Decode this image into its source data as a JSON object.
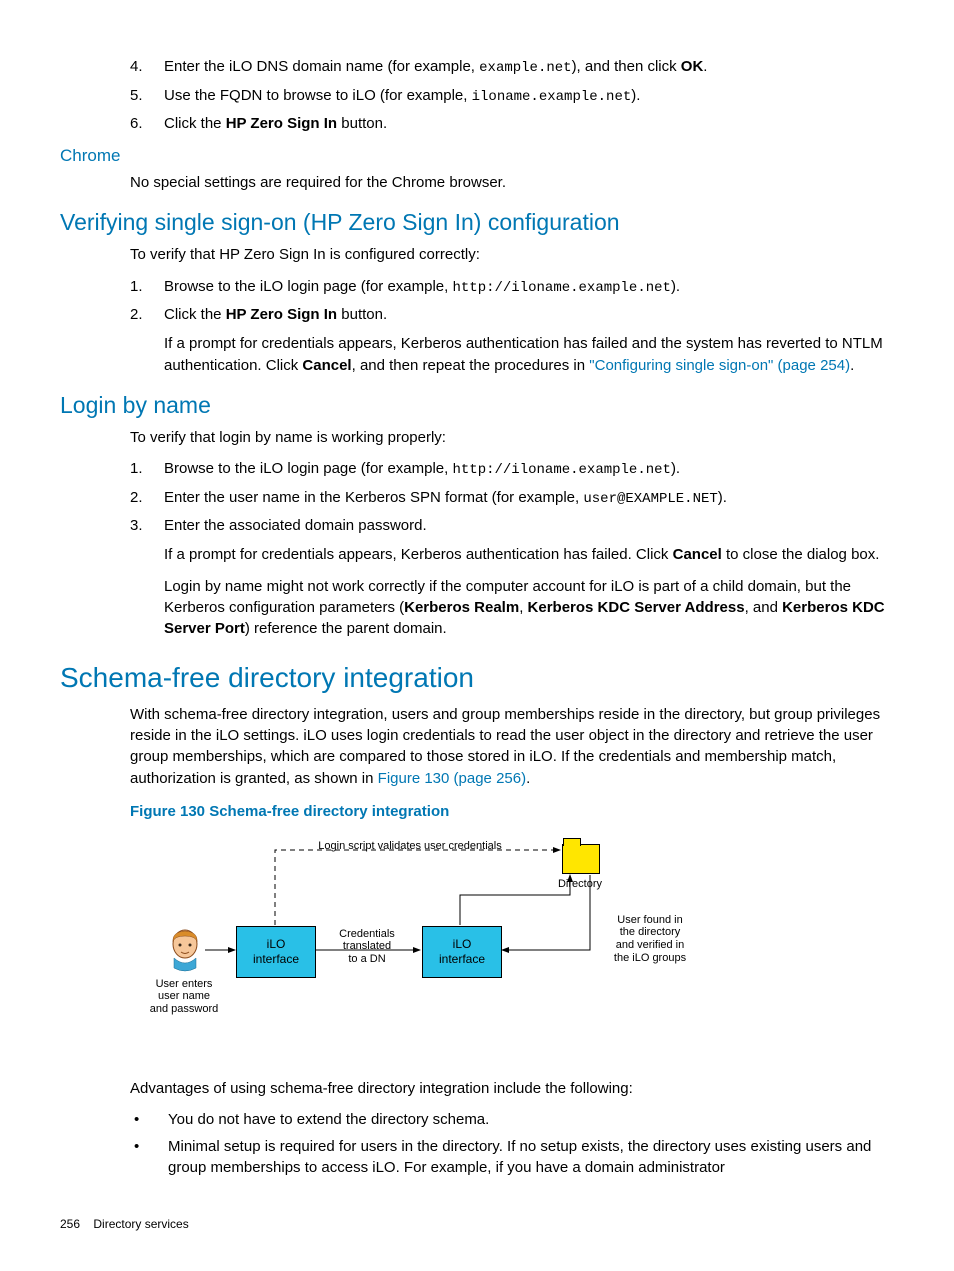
{
  "steps_top": [
    {
      "n": "4.",
      "pre": "Enter the iLO DNS domain name (for example, ",
      "code": "example.net",
      "mid": "), and then click ",
      "bold": "OK",
      "post": "."
    },
    {
      "n": "5.",
      "pre": "Use the FQDN to browse to iLO (for example, ",
      "code": "iloname.example.net",
      "post": ")."
    },
    {
      "n": "6.",
      "pre": "Click the ",
      "bold": "HP Zero Sign In",
      "post": " button."
    }
  ],
  "chrome": {
    "heading": "Chrome",
    "text": "No special settings are required for the Chrome browser."
  },
  "verify": {
    "heading": "Verifying single sign-on (HP Zero Sign In) configuration",
    "intro": "To verify that HP Zero Sign In is configured correctly:",
    "steps": [
      {
        "n": "1.",
        "pre": "Browse to the iLO login page (for example, ",
        "code": "http://iloname.example.net",
        "post": ")."
      },
      {
        "n": "2.",
        "pre": "Click the ",
        "bold": "HP Zero Sign In",
        "post": " button."
      }
    ],
    "followup_pre": "If a prompt for credentials appears, Kerberos authentication has failed and the system has reverted to NTLM authentication. Click ",
    "followup_bold": "Cancel",
    "followup_mid": ", and then repeat the procedures in ",
    "followup_link": "\"Configuring single sign-on\" (page 254)",
    "followup_post": "."
  },
  "login": {
    "heading": "Login by name",
    "intro": "To verify that login by name is working properly:",
    "steps": [
      {
        "n": "1.",
        "pre": "Browse to the iLO login page (for example, ",
        "code": "http://iloname.example.net",
        "post": ")."
      },
      {
        "n": "2.",
        "pre": "Enter the user name in the Kerberos SPN format (for example, ",
        "code": "user@EXAMPLE.NET",
        "post": ")."
      },
      {
        "n": "3.",
        "text": "Enter the associated domain password."
      }
    ],
    "p1_pre": "If a prompt for credentials appears, Kerberos authentication has failed. Click ",
    "p1_bold": "Cancel",
    "p1_post": " to close the dialog box.",
    "p2_pre": "Login by name might not work correctly if the computer account for iLO is part of a child domain, but the Kerberos configuration parameters (",
    "p2_b1": "Kerberos Realm",
    "p2_s1": ", ",
    "p2_b2": "Kerberos KDC Server Address",
    "p2_s2": ", and ",
    "p2_b3": "Kerberos KDC Server Port",
    "p2_post": ") reference the parent domain."
  },
  "schema": {
    "heading": "Schema-free directory integration",
    "intro_pre": "With schema-free directory integration, users and group memberships reside in the directory, but group privileges reside in the iLO settings. iLO uses login credentials to read the user object in the directory and retrieve the user group memberships, which are compared to those stored in iLO. If the credentials and membership match, authorization is granted, as shown in ",
    "intro_link": "Figure 130 (page 256)",
    "intro_post": ".",
    "fig_caption": "Figure 130 Schema-free directory integration",
    "diagram": {
      "top_label": "Login script validates user credentials",
      "directory": "Directory",
      "ilo_interface": "iLO\ninterface",
      "credentials": "Credentials\ntranslated\nto a DN",
      "user_enters": "User enters\nuser name\nand password",
      "user_found": "User found in\nthe directory\nand verified in\nthe iLO groups"
    },
    "advantages_intro": "Advantages of using schema-free directory integration include the following:",
    "bullets": [
      "You do not have to extend the directory schema.",
      "Minimal setup is required for users in the directory. If no setup exists, the directory uses existing users and group memberships to access iLO. For example, if you have a domain administrator"
    ]
  },
  "footer": {
    "page": "256",
    "title": "Directory services"
  }
}
